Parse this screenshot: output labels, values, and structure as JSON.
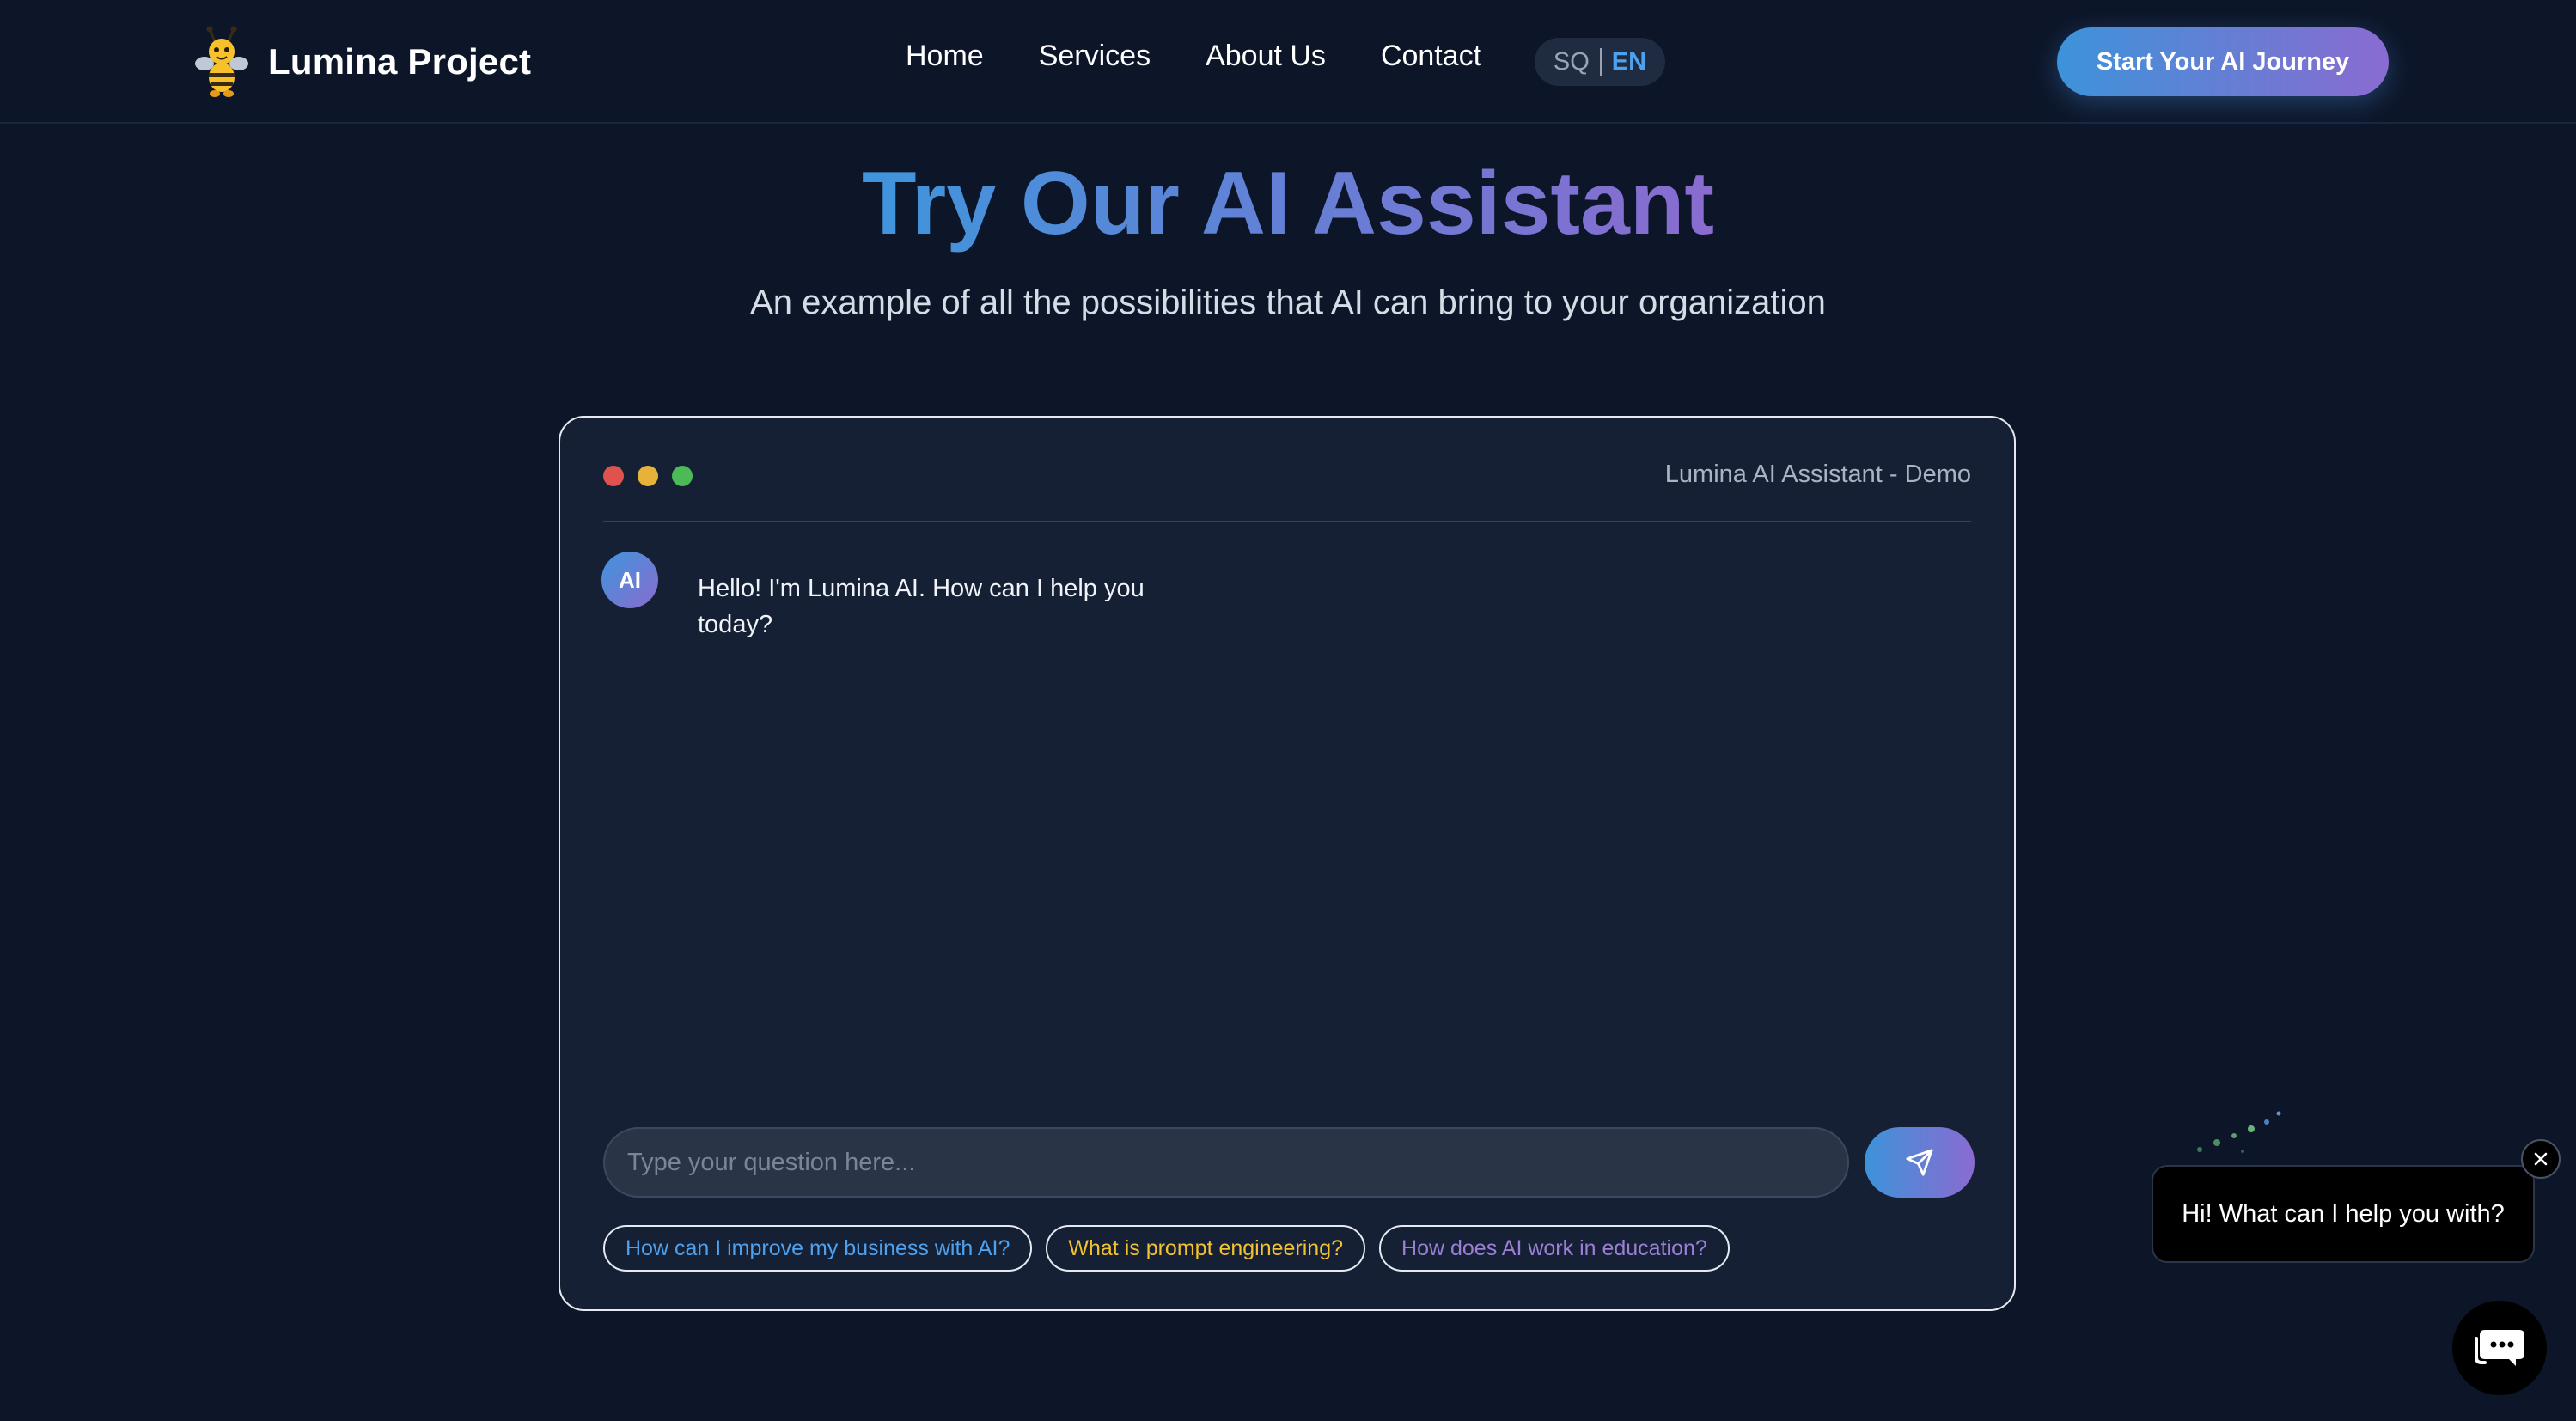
{
  "brand": {
    "name": "Lumina Project",
    "logo_icon": "bee-icon"
  },
  "nav": {
    "items": [
      {
        "label": "Home"
      },
      {
        "label": "Services"
      },
      {
        "label": "About Us"
      },
      {
        "label": "Contact"
      }
    ],
    "lang": {
      "sq": "SQ",
      "en": "EN",
      "active": "EN"
    },
    "cta": "Start Your AI Journey"
  },
  "hero": {
    "title": "Try Our AI Assistant",
    "subtitle": "An example of all the possibilities that AI can bring to your organization"
  },
  "chat": {
    "window_title": "Lumina AI Assistant - Demo",
    "avatar": "AI",
    "message": "Hello! I'm Lumina AI. How can I help you today?",
    "input_placeholder": "Type your question here...",
    "send_icon": "paper-plane-icon",
    "suggestions": [
      {
        "label": "How can I improve my business with AI?"
      },
      {
        "label": "What is prompt engineering?"
      },
      {
        "label": "How does AI work in education?"
      }
    ]
  },
  "widget": {
    "bubble_text": "Hi! What can I help you with?",
    "close_icon": "close-icon",
    "launcher_icon": "chat-icon"
  },
  "colors": {
    "background": "#0d1629",
    "panel": "#162034",
    "gradient_start": "#3f95dc",
    "gradient_end": "#8a6bcf",
    "chip_blue": "#4ea1ee",
    "chip_yellow": "#f2c230",
    "chip_purple": "#9b7fd6"
  }
}
